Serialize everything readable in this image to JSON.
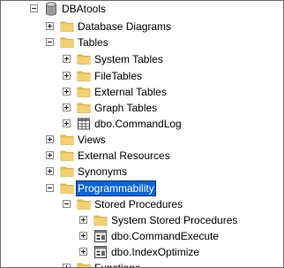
{
  "tree": {
    "db": {
      "label": "DBAtools",
      "expanded": true
    },
    "database_diagrams": {
      "label": "Database Diagrams",
      "expanded": false
    },
    "tables": {
      "label": "Tables",
      "expanded": true
    },
    "system_tables": {
      "label": "System Tables",
      "expanded": false
    },
    "filetables": {
      "label": "FileTables",
      "expanded": false
    },
    "external_tables": {
      "label": "External Tables",
      "expanded": false
    },
    "graph_tables": {
      "label": "Graph Tables",
      "expanded": false
    },
    "commandlog": {
      "label": "dbo.CommandLog",
      "expanded": false
    },
    "views": {
      "label": "Views",
      "expanded": false
    },
    "external_resources": {
      "label": "External Resources",
      "expanded": false
    },
    "synonyms": {
      "label": "Synonyms",
      "expanded": false
    },
    "programmability": {
      "label": "Programmability",
      "expanded": true,
      "selected": true
    },
    "stored_procedures": {
      "label": "Stored Procedures",
      "expanded": true
    },
    "system_stored_procedures": {
      "label": "System Stored Procedures",
      "expanded": false
    },
    "commandexecute": {
      "label": "dbo.CommandExecute",
      "expanded": false
    },
    "indexoptimize": {
      "label": "dbo.IndexOptimize",
      "expanded": false
    },
    "functions": {
      "label": "Functions",
      "expanded": false
    }
  },
  "colors": {
    "selection": "#0a64d2",
    "folder": "#e8c35a",
    "database": "#9a9a9a"
  }
}
